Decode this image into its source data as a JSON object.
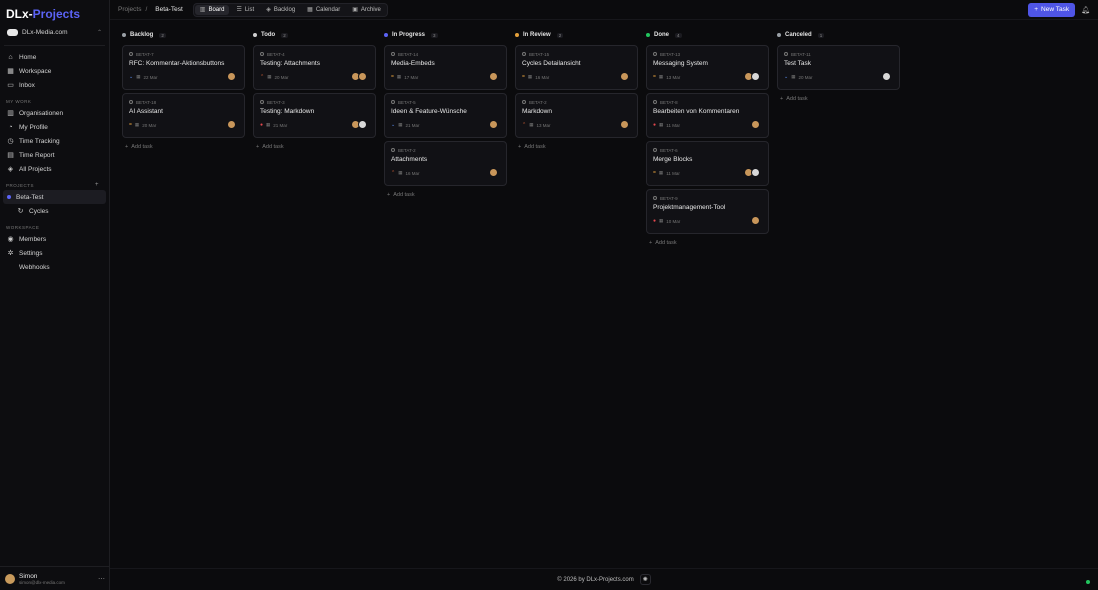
{
  "app": {
    "logo_a": "DLx-",
    "logo_b": "Projects"
  },
  "workspace": {
    "name": "DLx-Media.com"
  },
  "nav": [
    {
      "label": "Home",
      "icon": "⌂",
      "name": "home-icon"
    },
    {
      "label": "Workspace",
      "icon": "▦",
      "name": "workspace-icon"
    },
    {
      "label": "Inbox",
      "icon": "▭",
      "name": "inbox-icon"
    }
  ],
  "my_work_label": "MY WORK",
  "my_work": [
    {
      "label": "Organisationen",
      "icon": "▥",
      "name": "organisation-icon"
    },
    {
      "label": "My Profile",
      "icon": "◔",
      "name": "profile-icon"
    },
    {
      "label": "Time Tracking",
      "icon": "◷",
      "name": "clock-icon"
    },
    {
      "label": "Time Report",
      "icon": "▤",
      "name": "report-icon"
    },
    {
      "label": "All Projects",
      "icon": "◈",
      "name": "projects-icon"
    }
  ],
  "projects_label": "PROJECTS",
  "project": {
    "label": "Beta-Test",
    "sub": "Cycles"
  },
  "workspace_label": "WORKSPACE",
  "workspace_nav": [
    {
      "label": "Members",
      "icon": "◉",
      "name": "members-icon"
    },
    {
      "label": "Settings",
      "icon": "✲",
      "name": "settings-icon"
    },
    {
      "label": "Webhooks",
      "icon": "",
      "name": "webhooks-icon"
    }
  ],
  "user": {
    "name": "Simon",
    "email": "simon@dlx-media.com"
  },
  "topbar": {
    "crumb_root": "Projects",
    "crumb_current": "Beta-Test",
    "tabs": [
      "Board",
      "List",
      "Backlog",
      "Calendar",
      "Archive"
    ],
    "new_task": "New Task"
  },
  "columns": [
    {
      "name": "Backlog",
      "count": "2",
      "color": "#9aa0a6",
      "cards": [
        {
          "id": "BETAT-7",
          "title": "RFC: Kommentar-Aktionsbuttons",
          "date": "22 Mar",
          "prio": "⌄",
          "prio_color": "#5b8def",
          "avatars": [
            "a"
          ]
        },
        {
          "id": "BETAT-18",
          "title": "AI Assistant",
          "date": "20 Mar",
          "prio": "=",
          "prio_color": "#e5a13b",
          "avatars": [
            "a"
          ]
        }
      ]
    },
    {
      "name": "Todo",
      "count": "2",
      "color": "#d0d0d0",
      "cards": [
        {
          "id": "BETAT-4",
          "title": "Testing: Attachments",
          "date": "20 Mar",
          "prio": "⌃",
          "prio_color": "#ef6b3b",
          "avatars": [
            "a",
            "a"
          ]
        },
        {
          "id": "BETAT-3",
          "title": "Testing: Markdown",
          "date": "21 Mar",
          "prio": "●",
          "prio_color": "#e5484d",
          "avatars": [
            "a",
            "d"
          ]
        }
      ]
    },
    {
      "name": "In Progress",
      "count": "3",
      "color": "#5b63f5",
      "cards": [
        {
          "id": "BETAT-14",
          "title": "Media-Embeds",
          "date": "17 Mar",
          "prio": "=",
          "prio_color": "#e5a13b",
          "avatars": [
            "a"
          ]
        },
        {
          "id": "BETAT-5",
          "title": "Ideen & Feature-Wünsche",
          "date": "21 Mar",
          "prio": "⌄",
          "prio_color": "#5b8def",
          "avatars": [
            "a"
          ]
        },
        {
          "id": "BETAT-2",
          "title": "Attachments",
          "date": "16 Mar",
          "prio": "⌃",
          "prio_color": "#ef6b3b",
          "avatars": [
            "a"
          ]
        }
      ]
    },
    {
      "name": "In Review",
      "count": "2",
      "color": "#e5a13b",
      "cards": [
        {
          "id": "BETAT-15",
          "title": "Cycles Detailansicht",
          "date": "16 Mar",
          "prio": "=",
          "prio_color": "#e5a13b",
          "avatars": [
            "a"
          ]
        },
        {
          "id": "BETAT-2",
          "title": "Markdown",
          "date": "13 Mar",
          "prio": "⌃",
          "prio_color": "#ef6b3b",
          "avatars": [
            "a"
          ]
        }
      ]
    },
    {
      "name": "Done",
      "count": "4",
      "color": "#22c55e",
      "cards": [
        {
          "id": "BETAT-13",
          "title": "Messaging System",
          "date": "13 Mar",
          "prio": "=",
          "prio_color": "#e5a13b",
          "avatars": [
            "a",
            "d"
          ]
        },
        {
          "id": "BETAT-8",
          "title": "Bearbeiten von Kommentaren",
          "date": "11 Mar",
          "prio": "●",
          "prio_color": "#e5484d",
          "avatars": [
            "a"
          ]
        },
        {
          "id": "BETAT-6",
          "title": "Merge Blocks",
          "date": "11 Mar",
          "prio": "=",
          "prio_color": "#e5a13b",
          "avatars": [
            "a",
            "d"
          ]
        },
        {
          "id": "BETAT-9",
          "title": "Projektmanagement-Tool",
          "date": "10 Mar",
          "prio": "●",
          "prio_color": "#e5484d",
          "avatars": [
            "a"
          ]
        }
      ]
    },
    {
      "name": "Canceled",
      "count": "1",
      "color": "#9aa0a6",
      "cards": [
        {
          "id": "BETAT-11",
          "title": "Test Task",
          "date": "20 Mar",
          "prio": "⌄",
          "prio_color": "#5b8def",
          "avatars": [
            "d"
          ]
        }
      ]
    }
  ],
  "add_task": "Add task",
  "footer": {
    "text": "© 2026 by DLx-Projects.com"
  }
}
